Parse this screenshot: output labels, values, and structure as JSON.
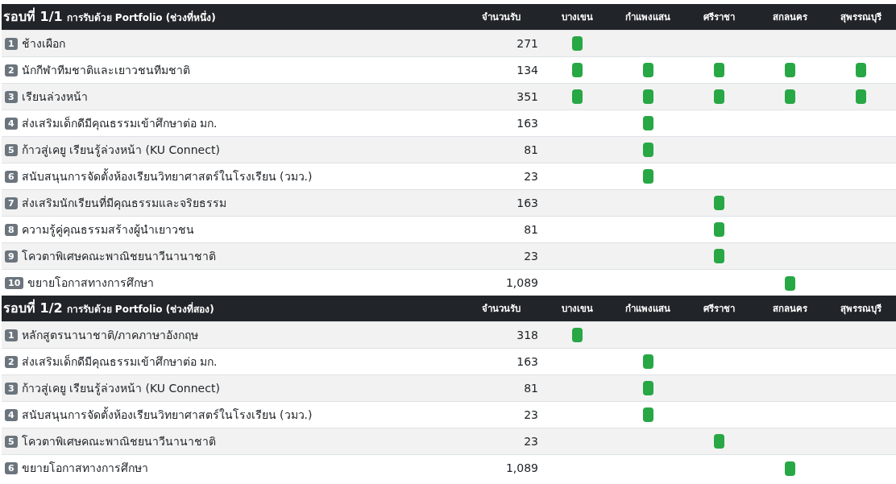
{
  "sections": [
    {
      "round": "รอบที่ 1/1",
      "subtitle": "การรับด้วย Portfolio (ช่วงที่หนึ่ง)",
      "count_header": "จำนวนรับ",
      "campus_headers": [
        "บางเขน",
        "กำแพงแสน",
        "ศรีราชา",
        "สกลนคร",
        "สุพรรณบุรี"
      ],
      "rows": [
        {
          "number": "1",
          "name": "ช้างเผือก",
          "count": "271",
          "campuses": [
            true,
            false,
            false,
            false,
            false
          ]
        },
        {
          "number": "2",
          "name": "นักกีฬาทีมชาติและเยาวชนทีมชาติ",
          "count": "134",
          "campuses": [
            true,
            true,
            true,
            true,
            true
          ]
        },
        {
          "number": "3",
          "name": "เรียนล่วงหน้า",
          "count": "351",
          "campuses": [
            true,
            true,
            true,
            true,
            true
          ]
        },
        {
          "number": "4",
          "name": "ส่งเสริมเด็กดีมีคุณธรรมเข้าศึกษาต่อ มก.",
          "count": "163",
          "campuses": [
            false,
            true,
            false,
            false,
            false
          ]
        },
        {
          "number": "5",
          "name": "ก้าวสู่เคยู เรียนรู้ล่วงหน้า (KU Connect)",
          "count": "81",
          "campuses": [
            false,
            true,
            false,
            false,
            false
          ]
        },
        {
          "number": "6",
          "name": "สนับสนุนการจัดตั้งห้องเรียนวิทยาศาสตร์ในโรงเรียน (วมว.)",
          "count": "23",
          "campuses": [
            false,
            true,
            false,
            false,
            false
          ]
        },
        {
          "number": "7",
          "name": "ส่งเสริมนักเรียนที่มีคุณธรรมและจริยธรรม",
          "count": "163",
          "campuses": [
            false,
            false,
            true,
            false,
            false
          ]
        },
        {
          "number": "8",
          "name": "ความรู้คู่คุณธรรมสร้างผู้นำเยาวชน",
          "count": "81",
          "campuses": [
            false,
            false,
            true,
            false,
            false
          ]
        },
        {
          "number": "9",
          "name": "โควตาพิเศษคณะพาณิชยนาวีนานาชาติ",
          "count": "23",
          "campuses": [
            false,
            false,
            true,
            false,
            false
          ]
        },
        {
          "number": "10",
          "name": "ขยายโอกาสทางการศึกษา",
          "count": "1,089",
          "campuses": [
            false,
            false,
            false,
            true,
            false
          ]
        }
      ]
    },
    {
      "round": "รอบที่ 1/2",
      "subtitle": "การรับด้วย Portfolio (ช่วงที่สอง)",
      "count_header": "จำนวนรับ",
      "campus_headers": [
        "บางเขน",
        "กำแพงแสน",
        "ศรีราชา",
        "สกลนคร",
        "สุพรรณบุรี"
      ],
      "rows": [
        {
          "number": "1",
          "name": "หลักสูตรนานาชาติ/ภาคภาษาอังกฤษ",
          "count": "318",
          "campuses": [
            true,
            false,
            false,
            false,
            false
          ]
        },
        {
          "number": "2",
          "name": "ส่งเสริมเด็กดีมีคุณธรรมเข้าศึกษาต่อ มก.",
          "count": "163",
          "campuses": [
            false,
            true,
            false,
            false,
            false
          ]
        },
        {
          "number": "3",
          "name": "ก้าวสู่เคยู เรียนรู้ล่วงหน้า (KU Connect)",
          "count": "81",
          "campuses": [
            false,
            true,
            false,
            false,
            false
          ]
        },
        {
          "number": "4",
          "name": "สนับสนุนการจัดตั้งห้องเรียนวิทยาศาสตร์ในโรงเรียน (วมว.)",
          "count": "23",
          "campuses": [
            false,
            true,
            false,
            false,
            false
          ]
        },
        {
          "number": "5",
          "name": "โควตาพิเศษคณะพาณิชยนาวีนานาชาติ",
          "count": "23",
          "campuses": [
            false,
            false,
            true,
            false,
            false
          ]
        },
        {
          "number": "6",
          "name": "ขยายโอกาสทางการศึกษา",
          "count": "1,089",
          "campuses": [
            false,
            false,
            false,
            true,
            false
          ]
        }
      ]
    }
  ]
}
